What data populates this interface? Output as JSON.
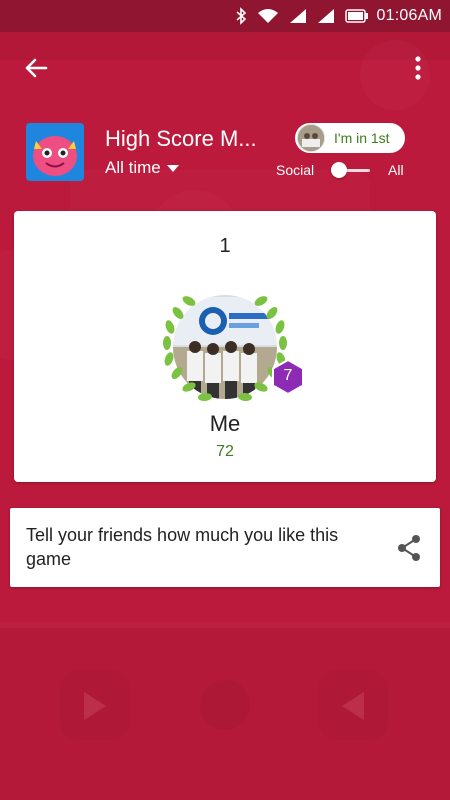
{
  "status_bar": {
    "time": "01:06AM"
  },
  "header": {
    "game_title": "High Score M...",
    "time_filter": "All time",
    "rank_chip": "I'm in 1st",
    "toggle_left": "Social",
    "toggle_right": "All",
    "toggle_state": "all"
  },
  "player": {
    "rank": "1",
    "name": "Me",
    "score": "72",
    "level": "7"
  },
  "share": {
    "text": "Tell your friends how much you like this game"
  },
  "colors": {
    "accent_green": "#3e7d1f",
    "level_badge": "#8e2bb5",
    "laurel": "#7cc242",
    "background": "#b81d3f"
  },
  "icons": [
    "back-arrow-icon",
    "more-vert-icon",
    "dropdown-icon",
    "share-icon",
    "laurel-icon",
    "level-badge-icon"
  ]
}
